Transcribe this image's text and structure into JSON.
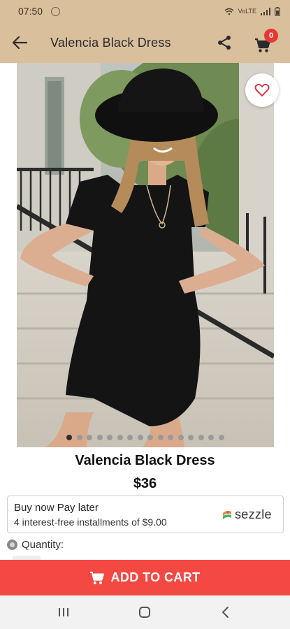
{
  "status_bar": {
    "time": "07:50",
    "network_label": "VoLTE",
    "icons": [
      "whatsapp-icon",
      "wifi-icon",
      "signal-icon",
      "battery-icon"
    ]
  },
  "app_bar": {
    "title": "Valencia Black Dress",
    "cart_count": "0",
    "icons": [
      "back-arrow-icon",
      "share-icon",
      "cart-icon"
    ],
    "background": "#d9bf9c"
  },
  "product": {
    "name": "Valencia Black Dress",
    "price": "$36",
    "image_count": 16,
    "active_image_index": 0
  },
  "sezzle": {
    "title": "Buy now Pay later",
    "installments_text": "4 interest-free installments of $9.00",
    "brand": "sezzle"
  },
  "quantity": {
    "label": "Quantity:"
  },
  "add_to_cart": {
    "label": "ADD TO CART",
    "color": "#f44842"
  },
  "nav": {
    "icons": [
      "recent-apps-icon",
      "home-icon",
      "back-icon"
    ]
  }
}
